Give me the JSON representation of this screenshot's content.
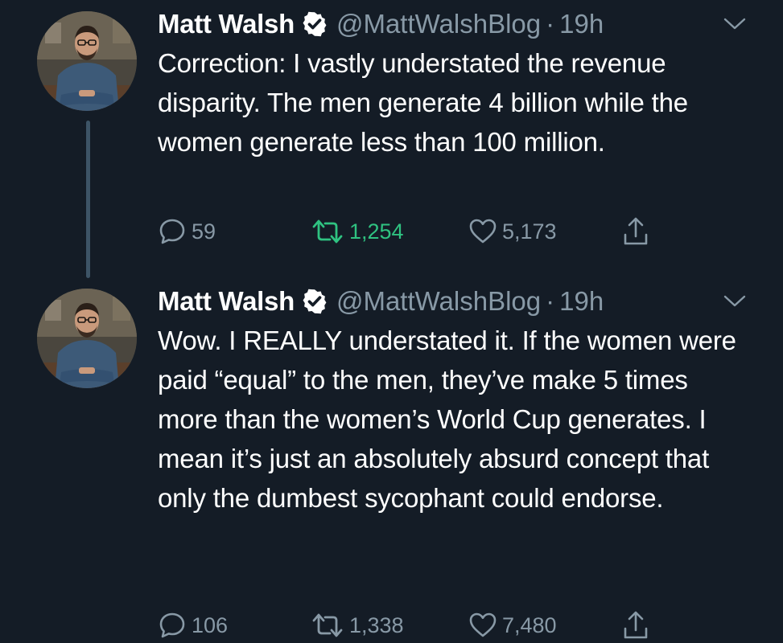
{
  "tweets": [
    {
      "author": {
        "name": "Matt Walsh",
        "verified": true,
        "handle": "@MattWalshBlog",
        "separator": "·",
        "time": "19h"
      },
      "text": "Correction: I vastly understated the revenue disparity. The men generate 4 billion while the women generate less than 100 million.",
      "stats": {
        "replies": "59",
        "retweets": "1,254",
        "likes": "5,173"
      },
      "retweeted": true,
      "icons": {
        "reply": "reply-icon",
        "retweet": "retweet-icon",
        "like": "heart-icon",
        "share": "share-icon",
        "menu": "chevron-down-icon"
      }
    },
    {
      "author": {
        "name": "Matt Walsh",
        "verified": true,
        "handle": "@MattWalshBlog",
        "separator": "·",
        "time": "19h"
      },
      "text": "Wow. I REALLY understated it. If the women were paid “equal” to the men, they’ve make 5 times more than the women’s World Cup generates. I mean it’s just an absolutely absurd concept that only the dumbest sycophant could endorse.",
      "stats": {
        "replies": "106",
        "retweets": "1,338",
        "likes": "7,480"
      },
      "retweeted": false,
      "icons": {
        "reply": "reply-icon",
        "retweet": "retweet-icon",
        "like": "heart-icon",
        "share": "share-icon",
        "menu": "chevron-down-icon"
      }
    }
  ],
  "colors": {
    "background": "#141c26",
    "text": "#ffffff",
    "muted": "#8899a6",
    "retweet_active": "#2fc281",
    "thread_line": "#3d5466"
  }
}
